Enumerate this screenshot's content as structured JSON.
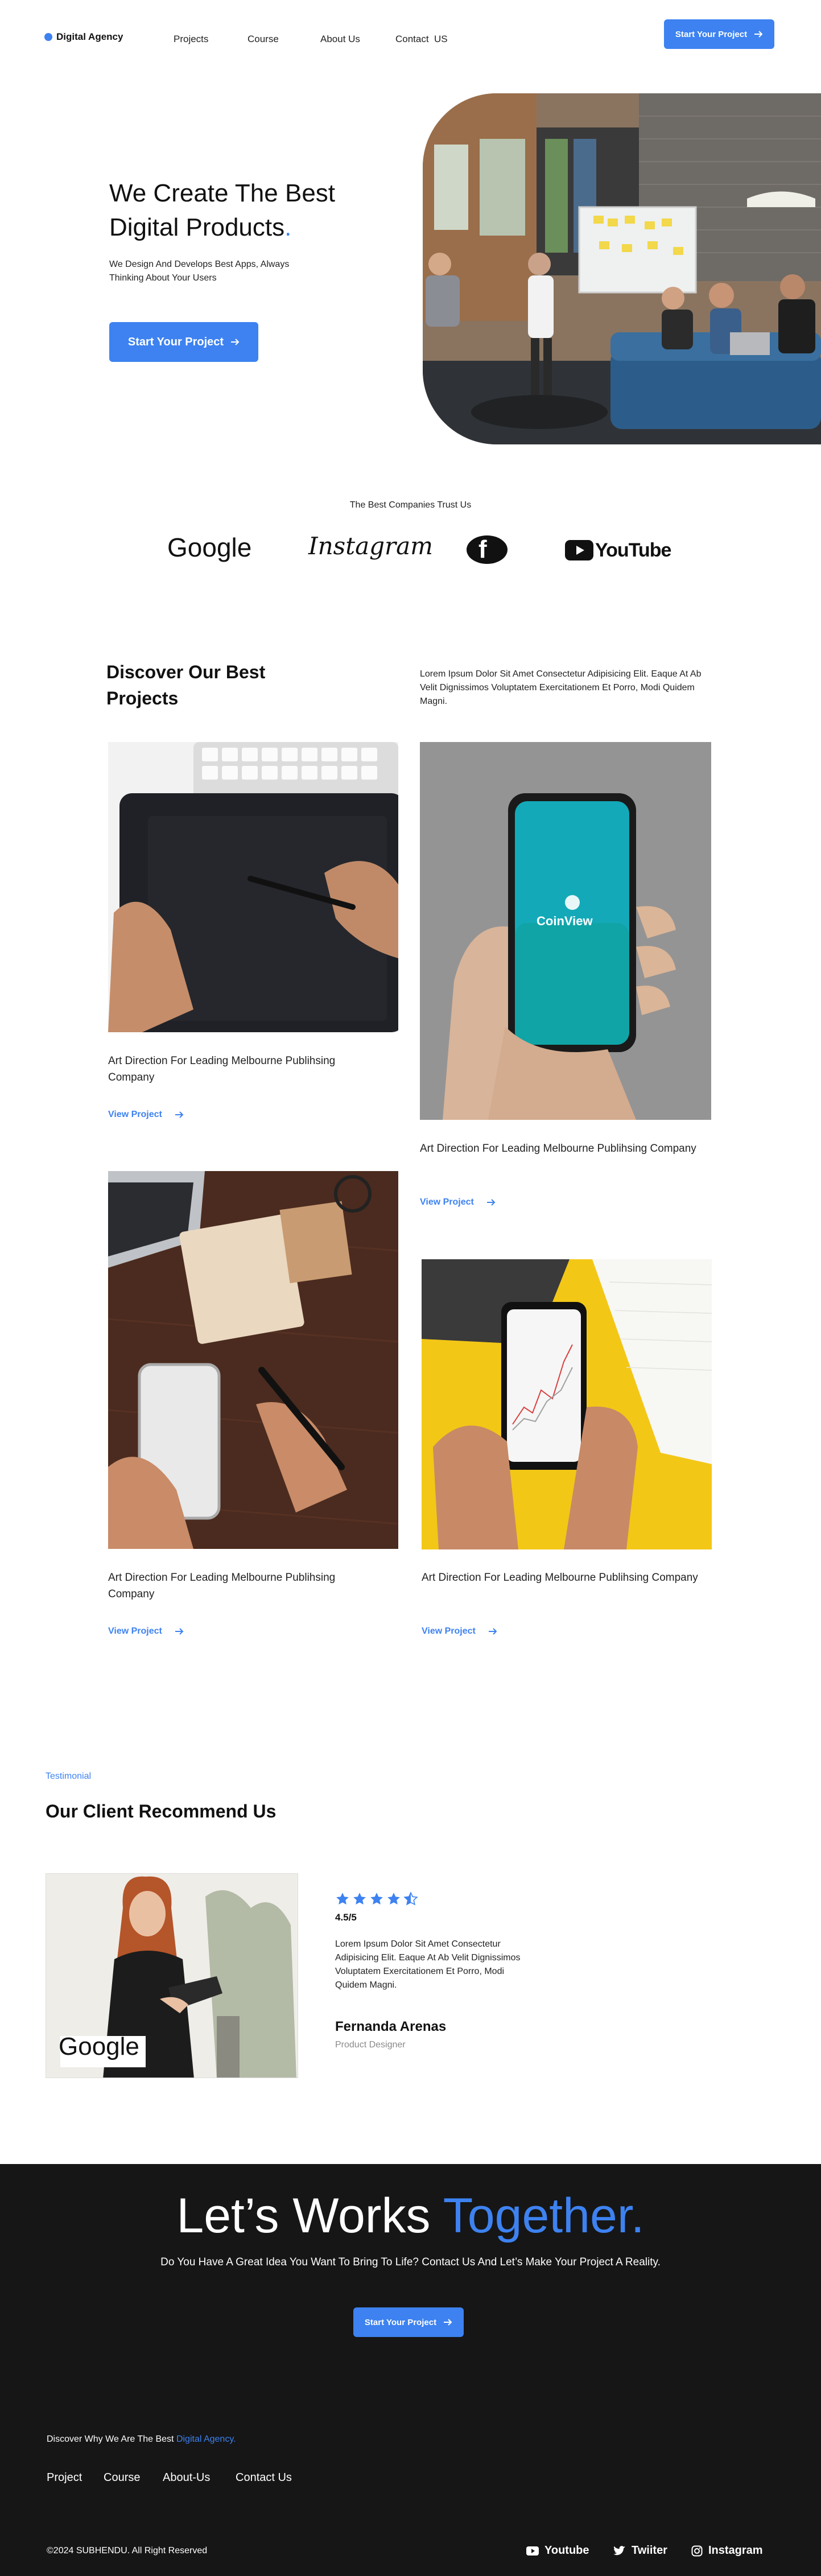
{
  "nav": {
    "logo": "Digital Agency",
    "links": [
      "Projects",
      "Course",
      "About Us",
      "Contact  US"
    ],
    "cta": "Start Your Project"
  },
  "hero": {
    "title_line1": "We Create The Best",
    "title_line2": "Digital Products",
    "title_dot": ".",
    "subtitle": "We Design And Develops Best Apps, Always Thinking About Your Users",
    "cta": "Start Your Project"
  },
  "trust": {
    "heading": "The Best Companies Trust Us",
    "brands": [
      "Google",
      "Instagram",
      "facebook",
      "YouTube"
    ]
  },
  "projects": {
    "title_line1": "Discover Our Best",
    "title_line2": "Projects",
    "description": "Lorem Ipsum Dolor Sit Amet Consectetur Adipisicing Elit. Eaque At Ab Velit Dignissimos Voluptatem Exercitationem Et Porro, Modi Quidem Magni.",
    "phone_app": "CoinView",
    "items": [
      {
        "title": "Art Direction For Leading Melbourne Publihsing Company",
        "link": "View Project"
      },
      {
        "title": "Art Direction For Leading Melbourne Publihsing Company",
        "link": "View Project"
      },
      {
        "title": "Art Direction For Leading Melbourne Publihsing Company",
        "link": "View Project"
      },
      {
        "title": "Art Direction For Leading Melbourne Publihsing Company",
        "link": "View Project"
      }
    ]
  },
  "testimonial": {
    "tag": "Testimonial",
    "title": "Our Client Recommend Us",
    "photo_logo": "Google",
    "rating": 4.5,
    "rating_label": "4.5/5",
    "quote": "Lorem Ipsum Dolor Sit Amet Consectetur Adipisicing Elit. Eaque At Ab Velit Dignissimos Voluptatem Exercitationem Et Porro, Modi Quidem Magni.",
    "name": "Fernanda Arenas",
    "role": "Product Designer"
  },
  "footer": {
    "title_white": "Let’s Works",
    "title_blue": "Together.",
    "subtitle": "Do You Have A Great Idea You Want To Bring To Life? Contact Us And Let’s Make Your Project A Reality.",
    "cta": "Start Your Project",
    "discover_text": "Discover Why We Are The Best",
    "discover_link": "Digital Agency.",
    "links": [
      "Project",
      "Course",
      "About-Us",
      "Contact Us"
    ],
    "copyright": "©2024 SUBHENDU. All Right Reserved",
    "socials": [
      "Youtube",
      "Twiiter",
      "Instagram"
    ]
  },
  "colors": {
    "accent": "#3d82f0",
    "footer_bg": "#161616",
    "text": "#111111"
  }
}
